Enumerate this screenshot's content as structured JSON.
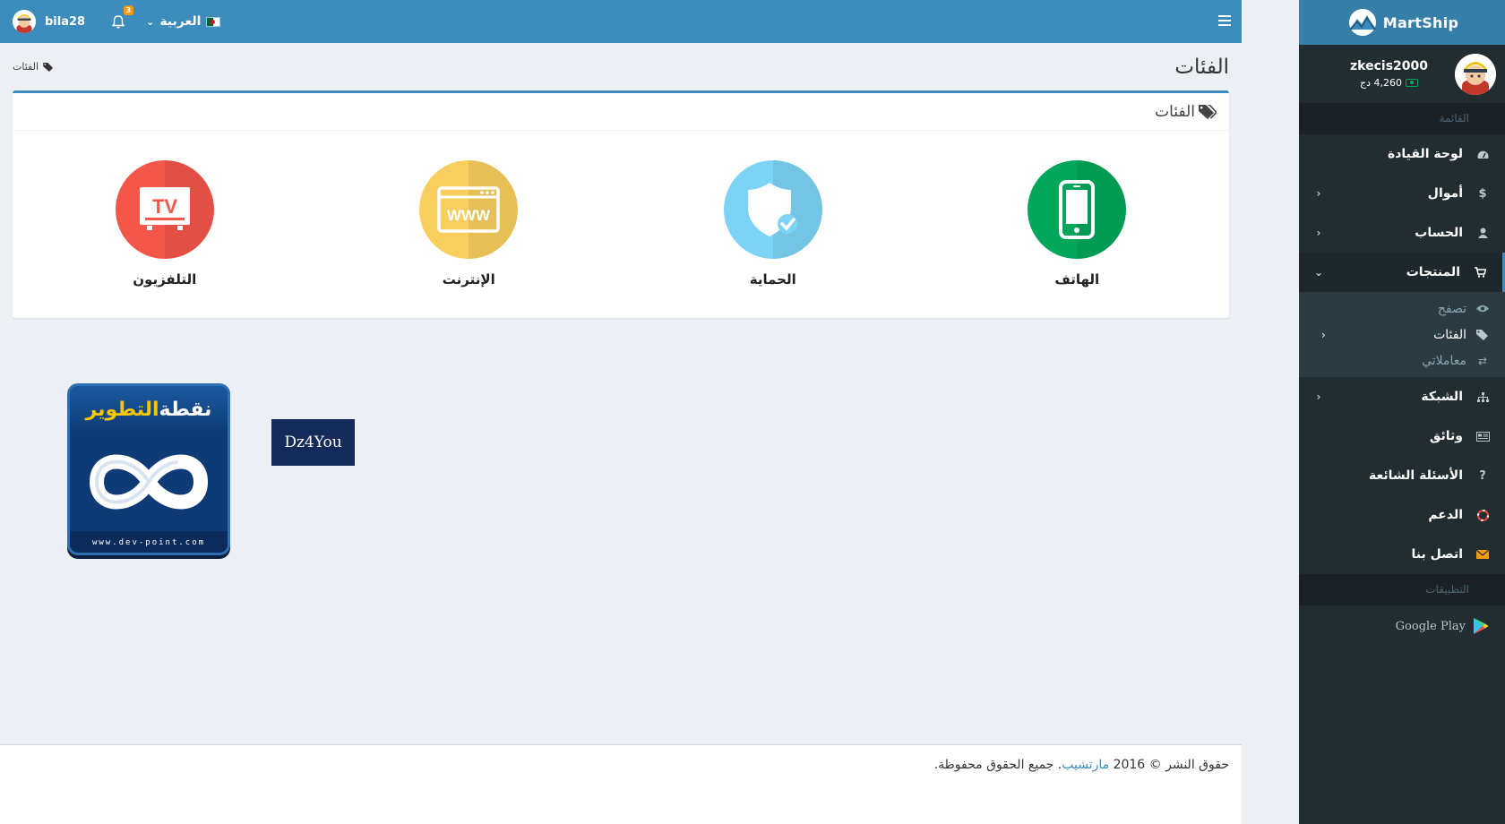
{
  "sidebar": {
    "brand": "MartShip",
    "user": {
      "name": "zkecis2000",
      "balance": "4,260 دج"
    },
    "menu_header": "القائمة",
    "items": [
      {
        "label": "لوحة القيادة",
        "icon": "dashboard-icon"
      },
      {
        "label": "أموال",
        "icon": "dollar-icon"
      },
      {
        "label": "الحساب",
        "icon": "user-icon"
      },
      {
        "label": "المنتجات",
        "icon": "cart-icon"
      },
      {
        "label": "الشبكة",
        "icon": "sitemap-icon"
      },
      {
        "label": "وثائق",
        "icon": "newspaper-icon"
      },
      {
        "label": "الأسئلة الشائعة",
        "icon": "question-icon"
      },
      {
        "label": "الدعم",
        "icon": "lifebuoy-icon"
      },
      {
        "label": "اتصل بنا",
        "icon": "envelope-icon"
      }
    ],
    "products_sub": [
      {
        "label": "تصفح",
        "icon": "eye-icon"
      },
      {
        "label": "الفئات",
        "icon": "tags-icon"
      },
      {
        "label": "معاملاتي",
        "icon": "exchange-icon"
      }
    ],
    "apps_header": "التطبيقات",
    "google_play": "Google Play"
  },
  "topbar": {
    "username": "bila28",
    "notifications_count": "3",
    "language": "العربية"
  },
  "page": {
    "title": "الفئات",
    "breadcrumb": "الفئات",
    "box_title": "الفئات",
    "categories": [
      {
        "label": "الهاتف",
        "color": "#00a65a"
      },
      {
        "label": "الحماية",
        "color": "#7dd3f5"
      },
      {
        "label": "الإنترنت",
        "color": "#f8cf5e"
      },
      {
        "label": "التلفزيون",
        "color": "#f4564a"
      }
    ]
  },
  "banners": {
    "dev_point_title_a": "نقطة",
    "dev_point_title_b": "التطوير",
    "dev_point_url": "www.dev-point.com",
    "dz4you": "Dz4You"
  },
  "footer": {
    "prefix": "حقوق النشر © 2016",
    "link": "مارتشيب",
    "suffix": ". جميع الحقوق محفوظة."
  }
}
